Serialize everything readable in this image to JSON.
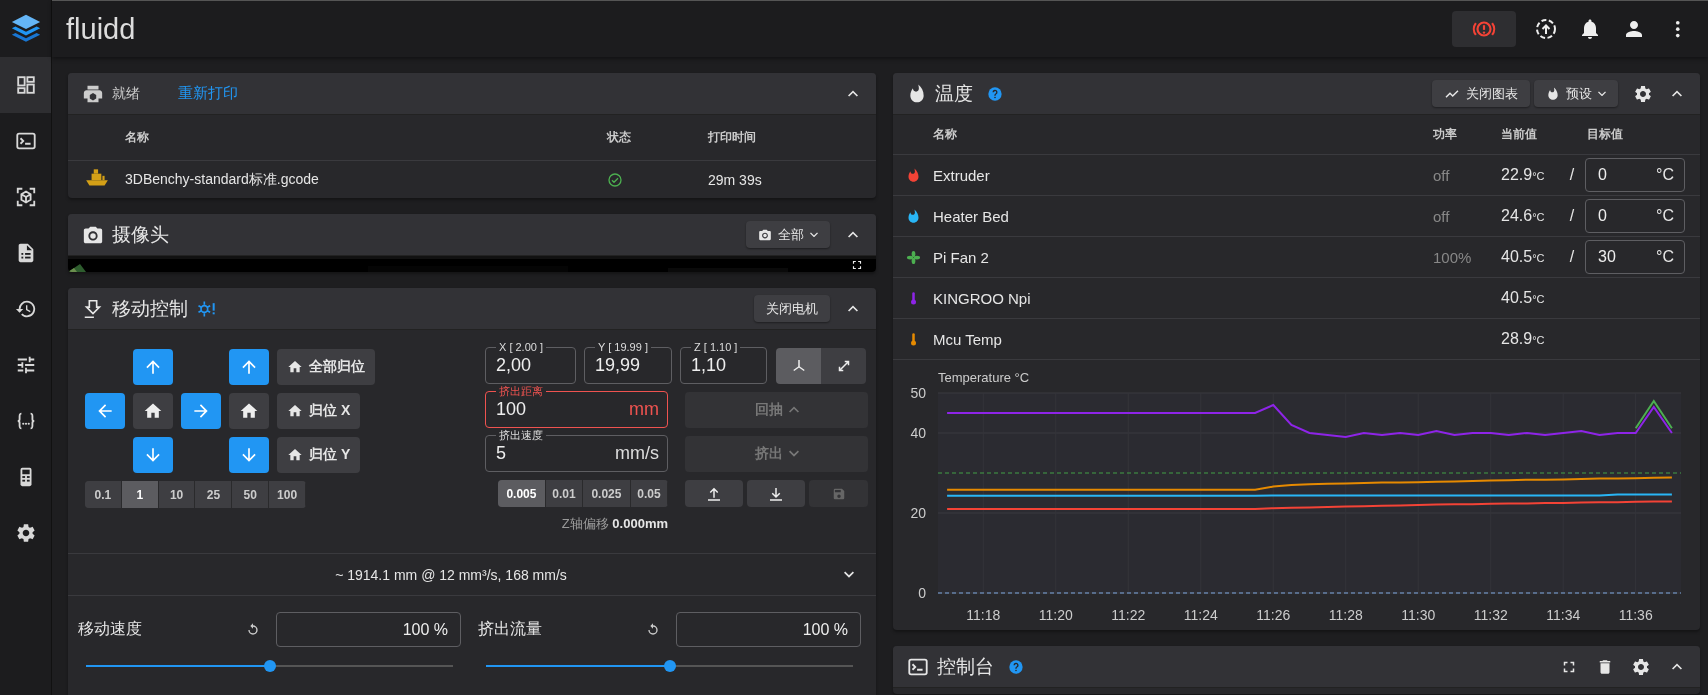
{
  "app": {
    "title": "fluidd"
  },
  "sidebar": {
    "items": [
      {
        "kind": "dashboard",
        "selected": true
      },
      {
        "kind": "console",
        "selected": false
      },
      {
        "kind": "cube",
        "selected": false
      },
      {
        "kind": "file",
        "selected": false
      },
      {
        "kind": "history",
        "selected": false
      },
      {
        "kind": "tune",
        "selected": false
      },
      {
        "kind": "braces",
        "selected": false
      },
      {
        "kind": "device",
        "selected": false
      },
      {
        "kind": "settings",
        "selected": false
      }
    ]
  },
  "status": {
    "state": "就绪",
    "reprint": "重新打印",
    "columns": [
      "名称",
      "状态",
      "打印时间"
    ],
    "rows": [
      {
        "name": "3DBenchy-standard标准.gcode",
        "finished": true,
        "time": "29m 39s"
      }
    ]
  },
  "camera": {
    "title": "摄像头",
    "filter": "全部"
  },
  "move": {
    "title": "移动控制",
    "motors_off": "关闭电机",
    "home_all": "全部归位",
    "home_x": "归位 X",
    "home_y": "归位 Y",
    "steps": [
      {
        "label": "0.1",
        "selected": false
      },
      {
        "label": "1",
        "selected": true
      },
      {
        "label": "10",
        "selected": false
      },
      {
        "label": "25",
        "selected": false
      },
      {
        "label": "50",
        "selected": false
      },
      {
        "label": "100",
        "selected": false
      }
    ],
    "positions": [
      {
        "label": "X [ 2.00 ]",
        "value": "2,00"
      },
      {
        "label": "Y [ 19.99 ]",
        "value": "19,99"
      },
      {
        "label": "Z [ 1.10 ]",
        "value": "1,10"
      }
    ],
    "coord_modes": [
      {
        "kind": "axes",
        "selected": true
      },
      {
        "kind": "expand",
        "selected": false
      }
    ],
    "extrude_length": {
      "label": "挤出距离",
      "value": "100",
      "unit": "mm",
      "error": true
    },
    "extrude_speed": {
      "label": "挤出速度",
      "value": "5",
      "unit": "mm/s",
      "error": false
    },
    "retract": {
      "label": "回抽",
      "disabled": true
    },
    "extrude": {
      "label": "挤出",
      "disabled": true
    },
    "z_steps": [
      {
        "label": "0.005",
        "selected": true
      },
      {
        "label": "0.01",
        "selected": false
      },
      {
        "label": "0.025",
        "selected": false
      },
      {
        "label": "0.05",
        "selected": false
      }
    ],
    "tool_buttons": [
      {
        "kind": "upload",
        "disabled": false
      },
      {
        "kind": "download",
        "disabled": false
      },
      {
        "kind": "save",
        "disabled": true
      }
    ],
    "z_offset": {
      "label": "Z轴偏移",
      "value": "0.000mm"
    },
    "summary": "~ 1914.1 mm @ 12 mm³/s, 168 mm/s",
    "speed": {
      "label": "移动速度",
      "value": "100 %",
      "level": 0.5
    },
    "flow": {
      "label": "挤出流量",
      "value": "100 %",
      "level": 0.5
    }
  },
  "temperature": {
    "title": "温度",
    "close_chart": "关闭图表",
    "presets": "预设",
    "columns": [
      "名称",
      "功率",
      "当前值",
      "目标值"
    ],
    "rows": [
      {
        "kind": "heater",
        "color": "#f44336",
        "name": "Extruder",
        "power": "off",
        "current": "22.9",
        "current_unit": "°C",
        "separator": "/",
        "target": "0",
        "target_unit": "°C"
      },
      {
        "kind": "heater",
        "color": "#29b6f6",
        "name": "Heater Bed",
        "power": "off",
        "current": "24.6",
        "current_unit": "°C",
        "separator": "/",
        "target": "0",
        "target_unit": "°C"
      },
      {
        "kind": "fan",
        "color": "#4caf50",
        "name": "Pi Fan 2",
        "power": "100%",
        "current": "40.5",
        "current_unit": "°C",
        "separator": "/",
        "target": "30",
        "target_unit": "°C"
      },
      {
        "kind": "sensor",
        "color": "#8e24e8",
        "name": "KINGROO Npi",
        "current": "40.5",
        "current_unit": "°C"
      },
      {
        "kind": "sensor",
        "color": "#e68a00",
        "name": "Mcu Temp",
        "current": "28.9",
        "current_unit": "°C"
      }
    ],
    "chart_data": {
      "type": "line",
      "title": "Temperature °C",
      "categories": [
        null,
        null,
        "11:18",
        null,
        null,
        null,
        "11:20",
        null,
        null,
        null,
        "11:22",
        null,
        null,
        null,
        "11:24",
        null,
        null,
        null,
        "11:26",
        null,
        null,
        null,
        "11:28",
        null,
        null,
        null,
        "11:30",
        null,
        null,
        null,
        "11:32",
        null,
        null,
        null,
        "11:34",
        null,
        null,
        null,
        "11:36",
        null,
        null
      ],
      "ylim": [
        0,
        50
      ],
      "yticks": [
        0,
        20,
        40,
        50
      ],
      "grid": true,
      "ref_lines": [
        {
          "axis": "y",
          "value": 0,
          "color": "#7fa8e0"
        },
        {
          "axis": "y",
          "value": 30,
          "color": "#43a047"
        }
      ],
      "series": [
        {
          "color": "#f44336",
          "values": [
            21,
            21,
            21,
            21,
            21,
            21,
            21,
            21,
            21,
            21,
            21,
            21,
            21,
            21,
            21,
            21,
            21,
            21,
            21.2,
            21.3,
            21.4,
            21.5,
            21.6,
            21.7,
            21.8,
            21.9,
            22,
            22.1,
            22.2,
            22.2,
            22.3,
            22.4,
            22.4,
            22.5,
            22.5,
            22.6,
            22.7,
            22.7,
            22.8,
            22.9,
            22.9
          ]
        },
        {
          "color": "#29b6f6",
          "values": [
            24.3,
            24.3,
            24.3,
            24.3,
            24.3,
            24.3,
            24.3,
            24.3,
            24.3,
            24.3,
            24.3,
            24.3,
            24.3,
            24.3,
            24.3,
            24.3,
            24.3,
            24.3,
            24.4,
            24.4,
            24.4,
            24.4,
            24.4,
            24.4,
            24.4,
            24.4,
            24.4,
            24.4,
            24.4,
            24.4,
            24.4,
            24.4,
            24.4,
            24.4,
            24.4,
            24.4,
            24.4,
            24.6,
            24.6,
            24.6,
            24.6
          ]
        },
        {
          "color": "#e68a00",
          "values": [
            25.8,
            25.8,
            25.8,
            25.8,
            25.8,
            25.8,
            25.8,
            25.8,
            25.8,
            25.8,
            25.8,
            25.8,
            25.8,
            25.8,
            25.8,
            25.8,
            25.8,
            25.8,
            26.6,
            27,
            27.2,
            27.3,
            27.4,
            27.5,
            27.6,
            27.6,
            27.7,
            27.8,
            27.9,
            28,
            28.1,
            28.2,
            28.3,
            28.3,
            28.4,
            28.5,
            28.6,
            28.6,
            28.7,
            28.8,
            28.9
          ]
        },
        {
          "color": "#4caf50",
          "values": [
            null,
            null,
            null,
            null,
            null,
            null,
            null,
            null,
            null,
            null,
            null,
            null,
            null,
            null,
            null,
            null,
            null,
            null,
            null,
            null,
            null,
            null,
            null,
            null,
            null,
            null,
            null,
            null,
            null,
            null,
            null,
            null,
            null,
            null,
            null,
            null,
            null,
            null,
            41.2,
            48,
            41.2
          ]
        },
        {
          "color": "#8e24e8",
          "values": [
            45,
            45,
            45,
            45,
            45,
            45,
            45,
            45,
            45,
            45,
            45,
            45,
            45,
            45,
            45,
            45,
            45,
            45,
            47,
            42,
            40,
            39.5,
            39,
            40,
            39.5,
            40,
            39.5,
            40.5,
            39.5,
            40,
            40,
            39.5,
            40,
            39.5,
            40,
            40.5,
            39.5,
            40,
            40,
            46.5,
            40
          ]
        }
      ]
    }
  },
  "console": {
    "title": "控制台"
  }
}
